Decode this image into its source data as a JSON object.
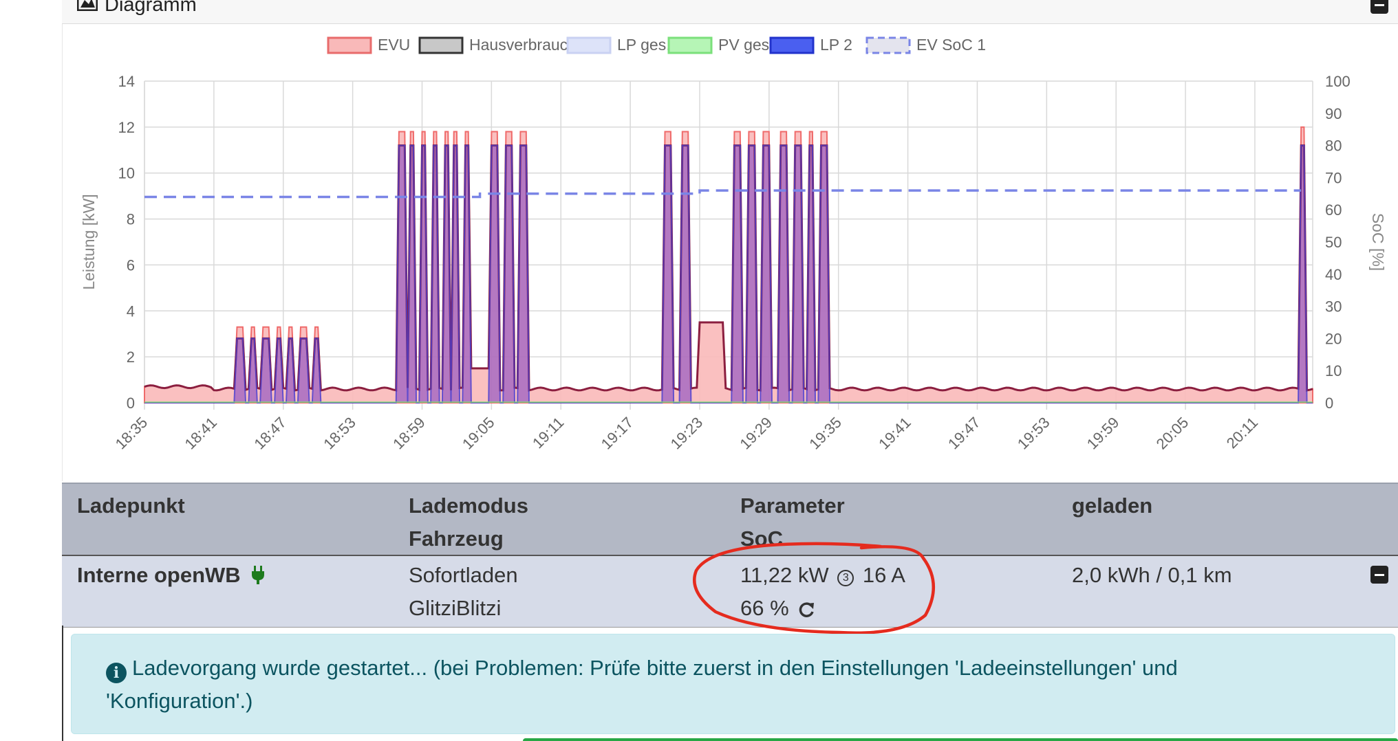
{
  "card": {
    "title": "Diagramm",
    "icon": "chart-area-icon"
  },
  "chart_data": {
    "type": "area",
    "legend": [
      {
        "label": "EVU",
        "fill": "#f9b9b9",
        "stroke": "#e86b6b"
      },
      {
        "label": "Hausverbrauch",
        "fill": "#c8c8c8",
        "stroke": "#333333"
      },
      {
        "label": "LP ges.",
        "fill": "#dde3f9",
        "stroke": "#c9d1f2"
      },
      {
        "label": "PV ges.",
        "fill": "#b6f5b6",
        "stroke": "#7be07b"
      },
      {
        "label": "LP 2",
        "fill": "#4a5ff0",
        "stroke": "#2233cc"
      },
      {
        "label": "EV SoC 1",
        "fill": "#e4e4ee",
        "stroke": "#7a85e6",
        "dashed": true
      }
    ],
    "legend_position": "top",
    "ylabel": "Leistung [kW]",
    "y2label": "SoC [%]",
    "ylim": [
      0,
      14
    ],
    "y2lim": [
      0,
      100
    ],
    "yticks": [
      "0",
      "2",
      "4",
      "6",
      "8",
      "10",
      "12",
      "14"
    ],
    "y2ticks": [
      "0",
      "10",
      "20",
      "30",
      "40",
      "50",
      "60",
      "70",
      "80",
      "90",
      "100"
    ],
    "xticks": [
      "18:35",
      "18:41",
      "18:47",
      "18:53",
      "18:59",
      "19:05",
      "19:11",
      "19:17",
      "19:23",
      "19:29",
      "19:35",
      "19:41",
      "19:47",
      "19:53",
      "19:59",
      "20:05",
      "20:11"
    ],
    "grid": true,
    "evu_baseline_kw": 0.6,
    "charging_bursts": [
      {
        "start": "18:43",
        "end": "18:50",
        "count": 7,
        "lp2_kw": 2.8,
        "evu_kw": 3.3
      },
      {
        "start": "18:57",
        "end": "19:03",
        "count": 7,
        "lp2_kw": 11.2,
        "evu_kw": 11.8
      },
      {
        "start": "19:05",
        "end": "19:08",
        "count": 3,
        "lp2_kw": 11.2,
        "evu_kw": 11.8
      },
      {
        "start": "19:20",
        "end": "19:22",
        "count": 2,
        "lp2_kw": 11.2,
        "evu_kw": 11.8
      },
      {
        "start": "19:26",
        "end": "19:29",
        "count": 3,
        "lp2_kw": 11.2,
        "evu_kw": 11.8
      },
      {
        "start": "19:30",
        "end": "19:34",
        "count": 4,
        "lp2_kw": 11.2,
        "evu_kw": 11.8
      },
      {
        "start": "20:15",
        "end": "20:15",
        "count": 1,
        "lp2_kw": 11.2,
        "evu_kw": 12.0
      }
    ],
    "house_plateaus": [
      {
        "start": "19:03",
        "end": "19:05",
        "kw": 1.5
      },
      {
        "start": "19:23",
        "end": "19:25",
        "kw": 3.5
      }
    ],
    "ev_soc": [
      {
        "from": "18:35",
        "to": "19:04",
        "value": 64
      },
      {
        "from": "19:04",
        "to": "19:23",
        "value": 65
      },
      {
        "from": "19:23",
        "to": "20:15",
        "value": 66
      }
    ]
  },
  "table": {
    "headers": {
      "col1": "Ladepunkt",
      "col2_line1": "Lademodus",
      "col2_line2": "Fahrzeug",
      "col3_line1": "Parameter",
      "col3_line2": "SoC",
      "col4": "geladen"
    },
    "row": {
      "name": "Interne openWB",
      "mode": "Sofortladen",
      "vehicle": "GlitziBlitzi",
      "power": "11,22 kW",
      "phases": "3",
      "current": "16 A",
      "soc": "66 %",
      "charged": "2,0 kWh / 0,1 km"
    }
  },
  "alert": {
    "text_line1": "Ladevorgang wurde gestartet... (bei Problemen: Prüfe bitte zuerst in den Einstellungen 'Ladeeinstellungen' und",
    "text_line2": "'Konfiguration'.)"
  },
  "colors": {
    "annotation_circle": "#e52b1e",
    "header_bg": "#b3b8c5",
    "row_bg": "#d6dbe8",
    "alert_bg": "#d1ecf1",
    "alert_text": "#0c5460",
    "plug_green": "#1e7b1e"
  }
}
